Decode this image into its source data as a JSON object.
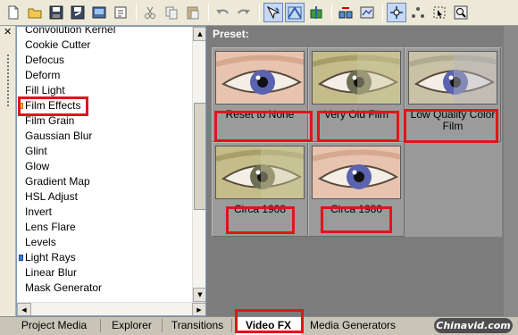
{
  "toolbar": {
    "icons": [
      "new-file-icon",
      "open-folder-icon",
      "save-icon",
      "save-as-icon",
      "render-icon",
      "properties-icon",
      "cut-icon",
      "copy-icon",
      "paste-icon",
      "undo-icon",
      "redo-icon",
      "normal-edit-tool-icon",
      "envelope-edit-tool-icon",
      "split-trim-icon",
      "auto-ripple-icon",
      "lock-envelopes-icon",
      "snapping-icon",
      "markers-icon",
      "selection-tool-icon",
      "zoom-tool-icon"
    ]
  },
  "effects_list": {
    "items": [
      {
        "label": "Convolution Kernel",
        "marker": ""
      },
      {
        "label": "Cookie Cutter",
        "marker": ""
      },
      {
        "label": "Defocus",
        "marker": ""
      },
      {
        "label": "Deform",
        "marker": ""
      },
      {
        "label": "Fill Light",
        "marker": ""
      },
      {
        "label": "Film Effects",
        "marker": "yellow"
      },
      {
        "label": "Film Grain",
        "marker": ""
      },
      {
        "label": "Gaussian Blur",
        "marker": ""
      },
      {
        "label": "Glint",
        "marker": ""
      },
      {
        "label": "Glow",
        "marker": ""
      },
      {
        "label": "Gradient Map",
        "marker": ""
      },
      {
        "label": "HSL Adjust",
        "marker": ""
      },
      {
        "label": "Invert",
        "marker": ""
      },
      {
        "label": "Lens Flare",
        "marker": ""
      },
      {
        "label": "Levels",
        "marker": ""
      },
      {
        "label": "Light Rays",
        "marker": "blue"
      },
      {
        "label": "Linear Blur",
        "marker": ""
      },
      {
        "label": "Mask Generator",
        "marker": ""
      }
    ],
    "selected": "Film Effects"
  },
  "preset": {
    "label": "Preset:",
    "tiles": [
      {
        "label": "Reset to None",
        "style": "color"
      },
      {
        "label": "Very Old Film",
        "style": "old"
      },
      {
        "label": "Low Quality Color Film",
        "style": "lowq"
      },
      {
        "label": "Circa 1908",
        "style": "old"
      },
      {
        "label": "Circa 1980",
        "style": "color"
      }
    ]
  },
  "tabs": {
    "items": [
      "Project Media",
      "Explorer",
      "Transitions",
      "Video FX",
      "Media Generators"
    ],
    "active": "Video FX"
  },
  "watermark": "Chinavid.com",
  "colors": {
    "highlight": "#e0151a",
    "preset_bg": "#7c7c7c"
  }
}
